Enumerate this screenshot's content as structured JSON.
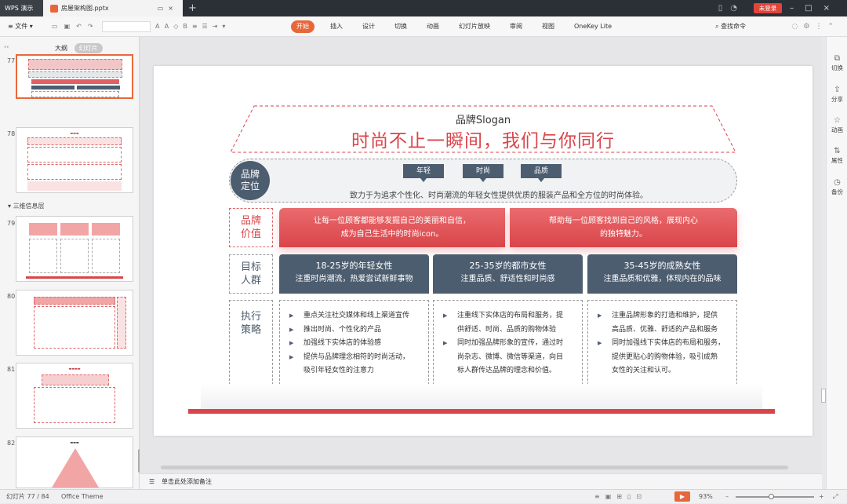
{
  "titlebar": {
    "app_name": "WPS 演示",
    "doc_tab": "房屋架构图.pptx",
    "login": "未登录"
  },
  "ribbon": {
    "file_menu": "文件",
    "tabs": [
      "开始",
      "插入",
      "设计",
      "切换",
      "动画",
      "幻灯片放映",
      "审阅",
      "视图",
      "OneKey Lite"
    ],
    "active_tab": "开始",
    "search": "查找命令"
  },
  "left_panel": {
    "tabs": [
      "大纲",
      "幻灯片"
    ],
    "active_tab": "幻灯片",
    "section_label": "三维信息层",
    "thumbnails": [
      {
        "num": "77"
      },
      {
        "num": "78"
      },
      {
        "num": "79"
      },
      {
        "num": "80"
      },
      {
        "num": "81"
      },
      {
        "num": "82"
      }
    ]
  },
  "right_rail": [
    "切换",
    "分享",
    "动画",
    "属性",
    "备份"
  ],
  "slide": {
    "brand_en": "品牌Slogan",
    "slogan": "时尚不止一瞬间，我们与你同行",
    "positioning_label": [
      "品牌",
      "定位"
    ],
    "tags": [
      "年轻",
      "时尚",
      "品质"
    ],
    "positioning_desc": "致力于为追求个性化、时尚潮流的年轻女性提供优质的服装产品和全方位的时尚体验。",
    "value_label": [
      "品牌",
      "价值"
    ],
    "values": [
      [
        "让每一位顾客都能够发掘自己的美丽和自信，",
        "成为自己生活中的时尚icon。"
      ],
      [
        "帮助每一位顾客找到自己的风格，展现内心",
        "的独特魅力。"
      ]
    ],
    "audience_label": [
      "目标",
      "人群"
    ],
    "audiences": [
      {
        "title": "18-25岁的年轻女性",
        "desc": "注重时尚潮流，热爱尝试新鲜事物"
      },
      {
        "title": "25-35岁的都市女性",
        "desc": "注重品质、舒适性和时尚感"
      },
      {
        "title": "35-45岁的成熟女性",
        "desc": "注重品质和优雅，体现内在的品味"
      }
    ],
    "strategy_label": [
      "执行",
      "策略"
    ],
    "strategies": [
      [
        "重点关注社交媒体和线上渠道宣传",
        "推出时尚、个性化的产品",
        "加强线下实体店的体验感",
        "提供与品牌理念相符的时尚活动，|吸引年轻女性的注意力"
      ],
      [
        "注重线下实体店的布局和服务，提|供舒适、时尚、品质的购物体验",
        "同时加强品牌形象的宣传，通过时|尚杂志、微博、微信等渠道，向目|标人群传达品牌的理念和价值。"
      ],
      [
        "注重品牌形象的打造和维护，提供|高品质、优雅、舒适的产品和服务",
        "同时加强线下实体店的布局和服务，|提供更贴心的购物体验，吸引成熟|女性的关注和认可。"
      ]
    ]
  },
  "notes_placeholder": "单击此处添加备注",
  "status": {
    "slide_counter": "幻灯片 77 / 84",
    "theme": "Office Theme",
    "zoom": "93%"
  },
  "colors": {
    "accent": "#e8673a",
    "brand_red": "#d9454a",
    "slate": "#4d5d70"
  }
}
